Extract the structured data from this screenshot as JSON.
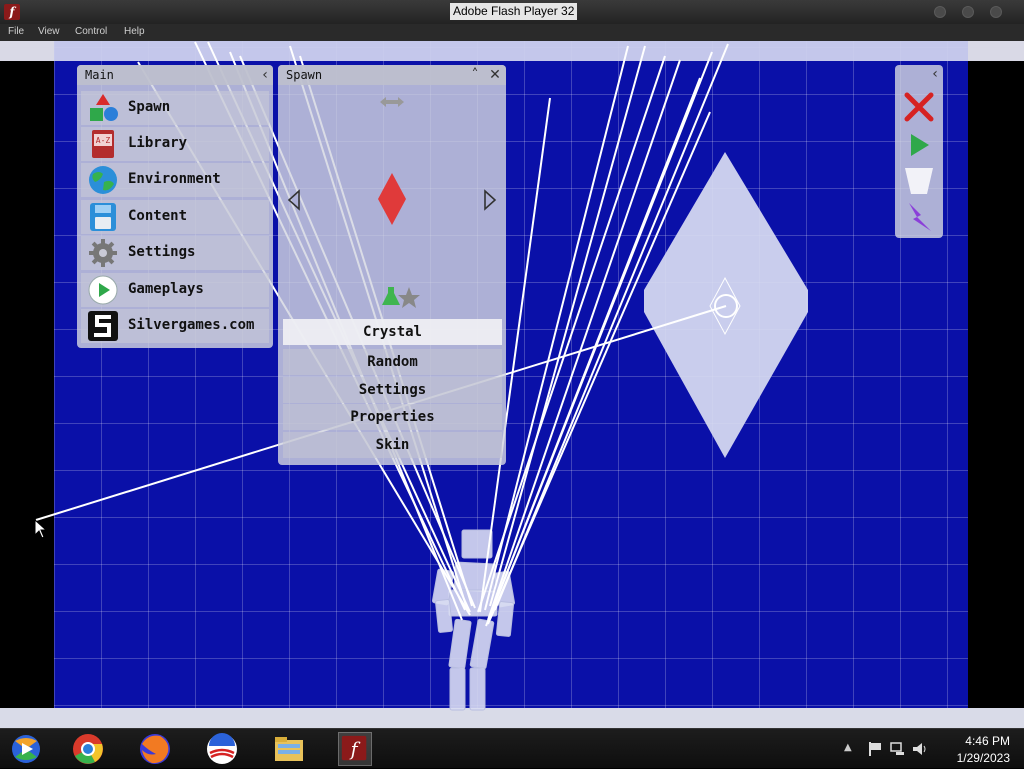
{
  "window": {
    "title": "Adobe Flash Player 32"
  },
  "menu": [
    "File",
    "View",
    "Control",
    "Help"
  ],
  "main_panel": {
    "title": "Main",
    "items": [
      {
        "label": "Spawn",
        "icon": "shapes-icon"
      },
      {
        "label": "Library",
        "icon": "library-book-icon"
      },
      {
        "label": "Environment",
        "icon": "globe-icon"
      },
      {
        "label": "Content",
        "icon": "floppy-disk-icon"
      },
      {
        "label": "Settings",
        "icon": "gear-icon"
      },
      {
        "label": "Gameplays",
        "icon": "play-icon"
      },
      {
        "label": "Silvergames.com",
        "icon": "silvergames-logo-icon"
      }
    ]
  },
  "spawn_panel": {
    "title": "Spawn",
    "items": [
      "Crystal",
      "Random",
      "Settings",
      "Properties",
      "Skin"
    ],
    "selected": "Crystal"
  },
  "tool_panel": {
    "tools": [
      "delete-x-icon",
      "play-icon",
      "bucket-icon",
      "lightning-icon"
    ]
  },
  "taskbar": {
    "apps": [
      "windows-media-icon",
      "chrome-icon",
      "firefox-icon",
      "obama-logo-icon",
      "file-explorer-icon",
      "flash-player-icon"
    ],
    "time": "4:46 PM",
    "date": "1/29/2023"
  },
  "colors": {
    "stage": "#0a10a8",
    "crystal": "#e03a3a",
    "diamond": "#d8dbf2"
  }
}
